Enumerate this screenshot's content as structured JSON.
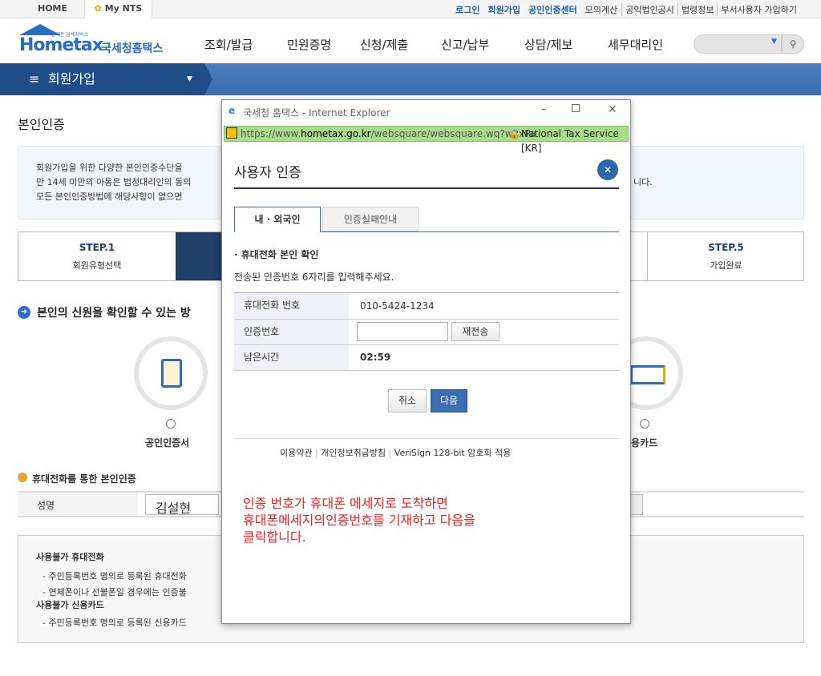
{
  "topbar": {
    "home": "HOME",
    "mynts": "My NTS",
    "links": [
      "로그인",
      "회원가입",
      "공인인증센터",
      "모의계산",
      "공익법인공시",
      "법령정보",
      "부서사용자 가입하기"
    ]
  },
  "logo": {
    "small": "언제든 납세서비스",
    "name": "Hometax",
    "kr": "국세청홈택스"
  },
  "nav": [
    "조회/발급",
    "민원증명",
    "신청/제출",
    "신고/납부",
    "상담/제보",
    "세무대리인"
  ],
  "menu": {
    "title": "회원가입"
  },
  "page": {
    "title": "본인인증",
    "info": [
      "회원가입을 위한 다양한 본인인증수단을",
      "만 14세 미만의 아동은 법정대리인의 동의",
      "모든 본인인증방법에 해당사항이 없으면"
    ],
    "info_tail": "니다.",
    "steps": [
      {
        "step": "STEP.1",
        "label": "회원유형선택"
      },
      {
        "step": "STEP.5",
        "label": "가입완료"
      }
    ],
    "section": "본인의 신원을 확인할 수 있는 방",
    "methods": [
      "공인인증서",
      "용카드"
    ],
    "phone_section": "휴대전화를 통한 본인인증",
    "name_label": "성명",
    "name_value": "김설현",
    "notice": {
      "h1": "사용불가 휴대전화",
      "l1": "- 주민등록번호 명의로 등록된 휴대전화",
      "l2": "- 연체폰이나 선불폰일 경우에는 인증불",
      "h2": "사용불가 신용카드",
      "l3": "- 주민등록번호 명의로 등록된 신용카드"
    }
  },
  "popup": {
    "window_title": "국세청 홈택스 - Internet Explorer",
    "url_https": "https://www.",
    "url_domain": "hometax.go.kr",
    "url_rest": "/websquare/websquare.wq?w2xPa",
    "cert": "National Tax Service [KR]",
    "title": "사용자 인증",
    "tabs": [
      "내 · 외국인",
      "인증실패안내"
    ],
    "sub": "휴대전화 본인 확인",
    "desc": "전송된 인증번호 6자리를 입력해주세요.",
    "rows": {
      "phone_label": "휴대전화 번호",
      "phone": "010-5424-1234",
      "code_label": "인증번호",
      "code_value": "",
      "resend": "재전송",
      "time_label": "남은시간",
      "time": "02:59"
    },
    "cancel": "취소",
    "next": "다음",
    "footer": [
      "이용약관",
      "개인정보취급방침",
      "VeriSign 128-bit 암호화 적용"
    ],
    "annotation": [
      "인증 번호가 휴대폰 메세지로 도착하면",
      "휴대폰메세지의인증번호를 기재하고 다음을",
      "클릭합니다."
    ]
  },
  "colors": {
    "brand": "#1d5ea8",
    "annotation": "#f02020"
  }
}
